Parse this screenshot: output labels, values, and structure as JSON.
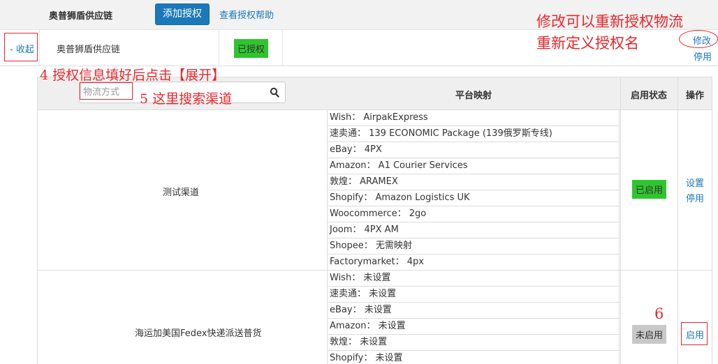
{
  "header": {
    "provider": "奥普狮盾供应链",
    "add_auth_button": "添加授权",
    "help_link": "查看授权帮助"
  },
  "provider_row": {
    "collapse": "- 收起",
    "name": "奥普狮盾供应链",
    "auth_status": "已授权",
    "modify": "修改",
    "disable": "停用"
  },
  "table": {
    "search_placeholder": "物流方式",
    "col_mapping": "平台映射",
    "col_status": "启用状态",
    "col_ops": "操作",
    "rows": [
      {
        "channel": "测试渠道",
        "mappings": [
          "Wish： AirpakExpress",
          "速卖通： 139 ECONOMIC Package (139俄罗斯专线)",
          "eBay： 4PX",
          "Amazon： A1 Courier Services",
          "敦煌： ARAMEX",
          "Shopify： Amazon Logistics UK",
          "Woocommerce： 2go",
          "Joom： 4PX AM",
          "Shopee： 无需映射",
          "Factorymarket： 4px"
        ],
        "status": "已启用",
        "op_settings": "设置",
        "op_disable": "停用"
      },
      {
        "channel": "海运加美国Fedex快递派送普货",
        "mappings": [
          "Wish： 未设置",
          "速卖通： 未设置",
          "eBay： 未设置",
          "Amazon： 未设置",
          "敦煌： 未设置",
          "Shopify： 未设置"
        ],
        "status": "未启用",
        "op_enable": "启用"
      }
    ]
  },
  "annotations": {
    "modify_hint_1": "修改可以重新授权物流",
    "modify_hint_2": "重新定义授权名",
    "step4": "4 授权信息填好后点击【展开】",
    "step5": "5 这里搜索渠道",
    "step6": "6"
  },
  "colors": {
    "primary": "#1b78b9",
    "enabled_badge": "#2fc52f",
    "disabled_badge": "#c8c8c8",
    "annotation_red": "#e8262b"
  }
}
